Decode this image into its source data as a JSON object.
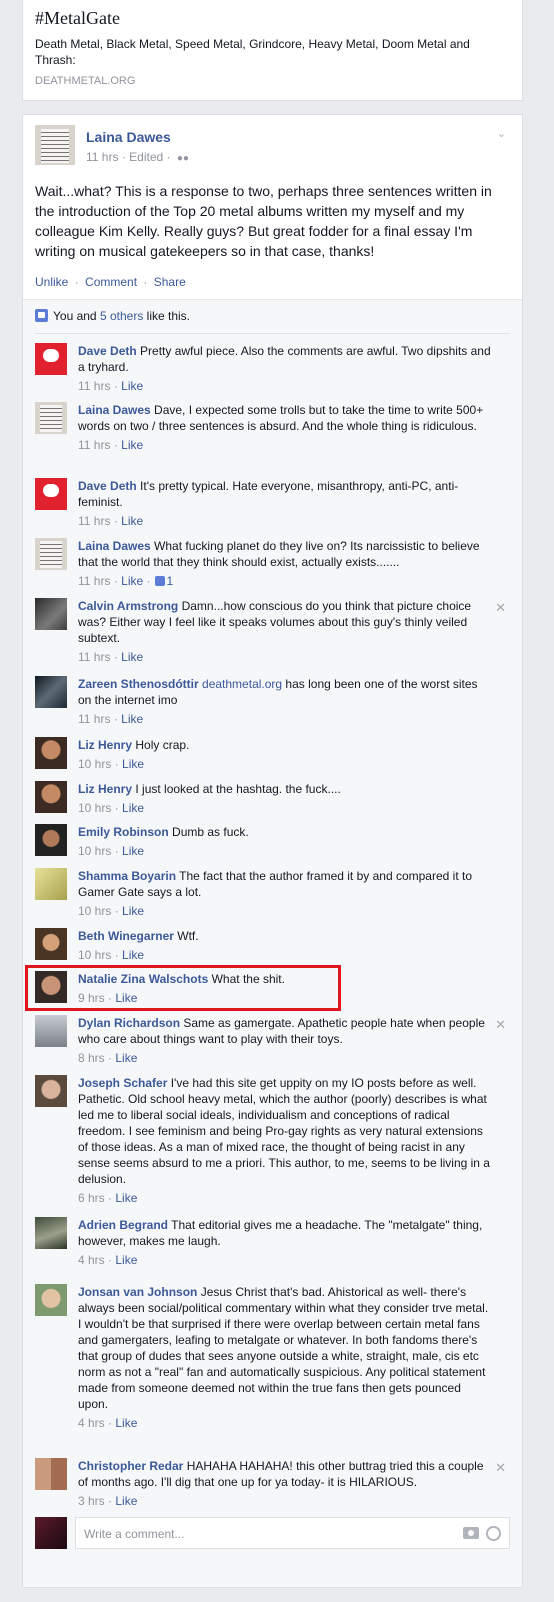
{
  "link_card": {
    "title": "#MetalGate",
    "description": "Death Metal, Black Metal, Speed Metal, Grindcore, Heavy Metal, Doom Metal and Thrash:",
    "domain": "DEATHMETAL.ORG"
  },
  "post": {
    "author": "Laina Dawes",
    "time": "11 hrs",
    "edited": "Edited",
    "meta_sep": "·",
    "text": "Wait...what? This is a response to two, perhaps three sentences written in the introduction of the Top 20 metal albums written my myself and my colleague Kim Kelly. Really guys? But great fodder for a final essay I'm writing on musical gatekeepers so in that case, thanks!",
    "actions": [
      "Unlike",
      "Comment",
      "Share"
    ],
    "action_sep": "·"
  },
  "likes": {
    "prefix": "You and ",
    "others": "5 others",
    "suffix": " like this."
  },
  "comments": [
    {
      "name": "Dave Deth",
      "text": "Pretty awful piece. Also the comments are awful. Two dipshits and a tryhard.",
      "time": "11 hrs",
      "like": "Like"
    },
    {
      "name": "Laina Dawes",
      "text": "Dave, I expected some trolls but to take the time to write 500+ words on two / three sentences is absurd. And the whole thing is ridiculous.",
      "time": "11 hrs",
      "like": "Like"
    },
    {
      "name": "Dave Deth",
      "text": "It's pretty typical. Hate everyone, misanthropy, anti-PC, anti-feminist.",
      "time": "11 hrs",
      "like": "Like"
    },
    {
      "name": "Laina Dawes",
      "text": "What fucking planet do they live on? Its narcissistic to believe that the world that they think should exist, actually exists.......",
      "time": "11 hrs",
      "like": "Like",
      "like_count": "1"
    },
    {
      "name": "Calvin Armstrong",
      "text": "Damn...how conscious do you think that picture choice was? Either way I feel like it speaks volumes about this guy's thinly veiled subtext.",
      "time": "11 hrs",
      "like": "Like"
    },
    {
      "name": "Zareen Sthenosdóttir",
      "link": "deathmetal.org",
      "text": " has long been one of the worst sites on the internet imo",
      "time": "11 hrs",
      "like": "Like"
    },
    {
      "name": "Liz Henry",
      "text": "Holy crap.",
      "time": "10 hrs",
      "like": "Like"
    },
    {
      "name": "Liz Henry",
      "text": "I just looked at the hashtag. the fuck....",
      "time": "10 hrs",
      "like": "Like"
    },
    {
      "name": "Emily Robinson",
      "text": "Dumb as fuck.",
      "time": "10 hrs",
      "like": "Like"
    },
    {
      "name": "Shamma Boyarin",
      "text": "The fact that the author framed it by and compared it to Gamer Gate says a lot.",
      "time": "10 hrs",
      "like": "Like"
    },
    {
      "name": "Beth Winegarner",
      "text": "Wtf.",
      "time": "10 hrs",
      "like": "Like"
    },
    {
      "name": "Natalie Zina Walschots",
      "text": "What the shit.",
      "time": "9 hrs",
      "like": "Like"
    },
    {
      "name": "Dylan Richardson",
      "text": "Same as gamergate. Apathetic people hate when people who care about things want to play with their toys.",
      "time": "8 hrs",
      "like": "Like"
    },
    {
      "name": "Joseph Schafer",
      "text": "I've had this site get uppity on my IO posts before as well. Pathetic. Old school heavy metal, which the author (poorly) describes is what led me to liberal social ideals, individualism and conceptions of radical freedom. I see feminism and being Pro-gay rights as very natural extensions of those ideas. As a man of mixed race, the thought of being racist in any sense seems absurd to me a priori. This author, to me, seems to be living in a delusion.",
      "time": "6 hrs",
      "like": "Like"
    },
    {
      "name": "Adrien Begrand",
      "text": "That editorial gives me a headache. The \"metalgate\" thing, however, makes me laugh.",
      "time": "4 hrs",
      "like": "Like"
    },
    {
      "name": "Jonsan van Johnson",
      "text": "Jesus Christ that's bad. Ahistorical as well- there's always been social/political commentary within what they consider trve metal.",
      "text2": "I wouldn't be that surprised if there were overlap between certain metal fans and gamergaters, leafing to metalgate or whatever. In both fandoms there's that group of dudes that sees anyone outside a white, straight, male, cis etc norm as not a \"real\" fan and automatically suspicious. Any political statement made from someone deemed not within the true fans then gets pounced upon.",
      "time": "4 hrs",
      "like": "Like"
    },
    {
      "name": "Christopher Redar",
      "text": "HAHAHA HAHAHA! this other buttrag tried this a couple of months ago. I'll dig that one up for ya today- it is HILARIOUS.",
      "time": "3 hrs",
      "like": "Like"
    }
  ],
  "meta_sep": "·",
  "write_comment": {
    "placeholder": "Write a comment..."
  },
  "icons": {
    "chevron": "chevron-down-icon",
    "audience": "friends-icon",
    "like": "thumbs-up-icon",
    "close": "close-icon",
    "camera": "camera-icon",
    "emoji": "smiley-icon"
  },
  "colors": {
    "link": "#3b5998",
    "highlight": "#e0161e",
    "muted": "#90949c"
  }
}
